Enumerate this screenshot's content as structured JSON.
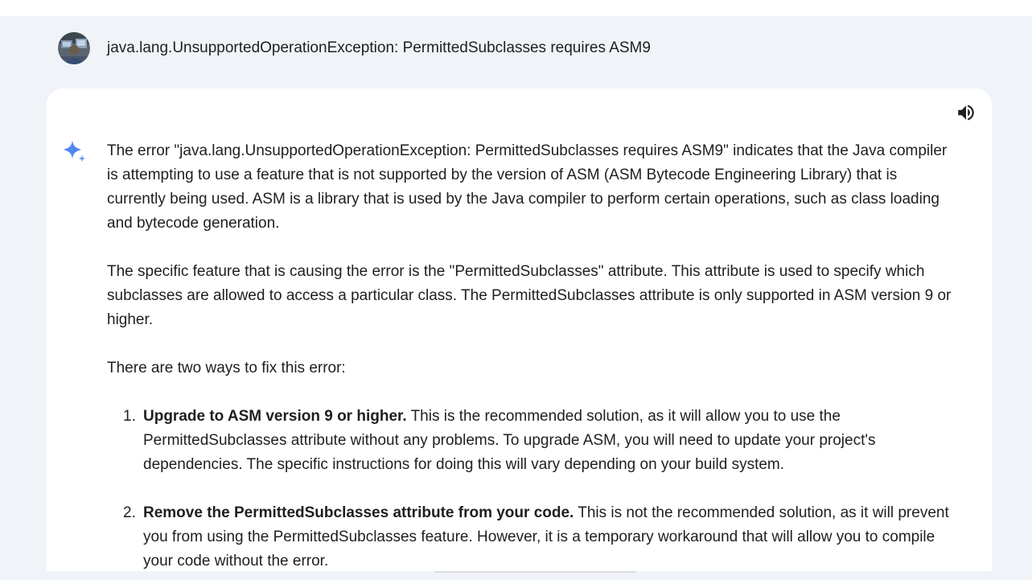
{
  "user_prompt": {
    "text": "java.lang.UnsupportedOperationException: PermittedSubclasses requires ASM9",
    "avatar_icon": "user-avatar-photo"
  },
  "response": {
    "speaker_icon": "volume-icon",
    "sparkle_icon": "gemini-sparkle-icon",
    "paragraphs": [
      "The error \"java.lang.UnsupportedOperationException: PermittedSubclasses requires ASM9\" indicates that the Java compiler is attempting to use a feature that is not supported by the version of ASM (ASM Bytecode Engineering Library) that is currently being used. ASM is a library that is used by the Java compiler to perform certain operations, such as class loading and bytecode generation.",
      "The specific feature that is causing the error is the \"PermittedSubclasses\" attribute. This attribute is used to specify which subclasses are allowed to access a particular class. The PermittedSubclasses attribute is only supported in ASM version 9 or higher.",
      "There are two ways to fix this error:"
    ],
    "list": [
      {
        "number": "1.",
        "bold": "Upgrade to ASM version 9 or higher.",
        "text": " This is the recommended solution, as it will allow you to use the PermittedSubclasses attribute without any problems. To upgrade ASM, you will need to update your project's dependencies. The specific instructions for doing this will vary depending on your build system."
      },
      {
        "number": "2.",
        "bold": "Remove the PermittedSubclasses attribute from your code.",
        "text": " This is not the recommended solution, as it will prevent you from using the PermittedSubclasses feature. However, it is a temporary workaround that will allow you to compile your code without the error."
      }
    ]
  },
  "colors": {
    "background": "#f0f4f9",
    "card": "#ffffff",
    "text": "#1f1f1f",
    "sparkle_blue": "#4f86ef"
  }
}
